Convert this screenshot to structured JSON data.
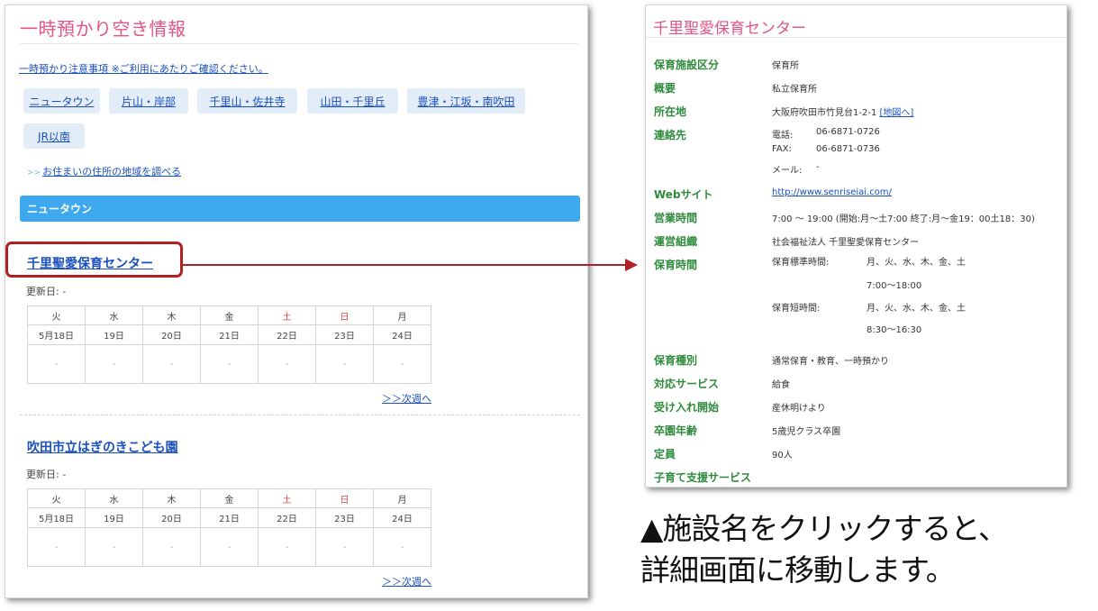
{
  "left": {
    "title": "一時預かり空き情報",
    "notice_link": "一時預かり注意事項 ※ご利用にあたりご確認ください。",
    "area_buttons": [
      "ニュータウン",
      "片山・岸部",
      "千里山・佐井寺",
      "山田・千里丘",
      "豊津・江坂・南吹田",
      "JR以南"
    ],
    "lookup_prefix": ">>",
    "lookup_link": "お住まいの住所の地域を調べる",
    "region_header": "ニュータウン",
    "facilities": [
      {
        "name": "千里聖愛保育センター",
        "updated": "更新日: -",
        "days": [
          "火",
          "水",
          "木",
          "金",
          "土",
          "日",
          "月"
        ],
        "dates": [
          "5月18日",
          "19日",
          "20日",
          "21日",
          "22日",
          "23日",
          "24日"
        ],
        "slots": [
          "-",
          "-",
          "-",
          "-",
          "-",
          "-",
          "-"
        ],
        "next_week": "＞＞次週へ"
      },
      {
        "name": "吹田市立はぎのきこども園",
        "updated": "更新日: -",
        "days": [
          "火",
          "水",
          "木",
          "金",
          "土",
          "日",
          "月"
        ],
        "dates": [
          "5月18日",
          "19日",
          "20日",
          "21日",
          "22日",
          "23日",
          "24日"
        ],
        "slots": [
          "-",
          "-",
          "-",
          "-",
          "-",
          "-",
          "-"
        ],
        "next_week": "＞＞次週へ"
      }
    ]
  },
  "right": {
    "title": "千里聖愛保育センター",
    "rows": {
      "category_label": "保育施設区分",
      "category_value": "保育所",
      "overview_label": "概要",
      "overview_value": "私立保育所",
      "address_label": "所在地",
      "address_value": "大阪府吹田市竹見台1-2-1",
      "map_link": "[地図へ]",
      "contact_label": "連絡先",
      "tel_label": "電話:",
      "tel_value": "06-6871-0726",
      "fax_label": "FAX:",
      "fax_value": "06-6871-0736",
      "mail_label": "メール:",
      "mail_value": "-",
      "web_label": "Webサイト",
      "web_value": "http://www.senriseiai.com/",
      "hours_label": "営業時間",
      "hours_value": "7:00 〜 19:00 (開始:月〜土7:00 終了:月〜金19：00土18：30)",
      "org_label": "運営組織",
      "org_value": "社会福祉法人 千里聖愛保育センター",
      "care_time_label": "保育時間",
      "std_label": "保育標準時間:",
      "std_days": "月、火、水、木、金、土",
      "std_time": "7:00〜18:00",
      "short_label": "保育短時間:",
      "short_days": "月、火、水、木、金、土",
      "short_time": "8:30〜16:30",
      "type_label": "保育種別",
      "type_value": "通常保育・教育、一時預かり",
      "service_label": "対応サービス",
      "service_value": "給食",
      "accept_label": "受け入れ開始",
      "accept_value": "産休明けより",
      "grad_label": "卒園年齢",
      "grad_value": "5歳児クラス卒園",
      "capacity_label": "定員",
      "capacity_value": "90人",
      "support_label": "子育て支援サービス"
    }
  },
  "caption": {
    "line1": "▲施設名をクリックすると、",
    "line2": "詳細画面に移動します。"
  },
  "colors": {
    "title_pink": "#e05586",
    "link_blue": "#1a4fbf",
    "region_bar": "#3fa9f0",
    "label_green": "#2e8b3b",
    "highlight_red": "#b21f24",
    "weekend_red": "#dd4444"
  }
}
